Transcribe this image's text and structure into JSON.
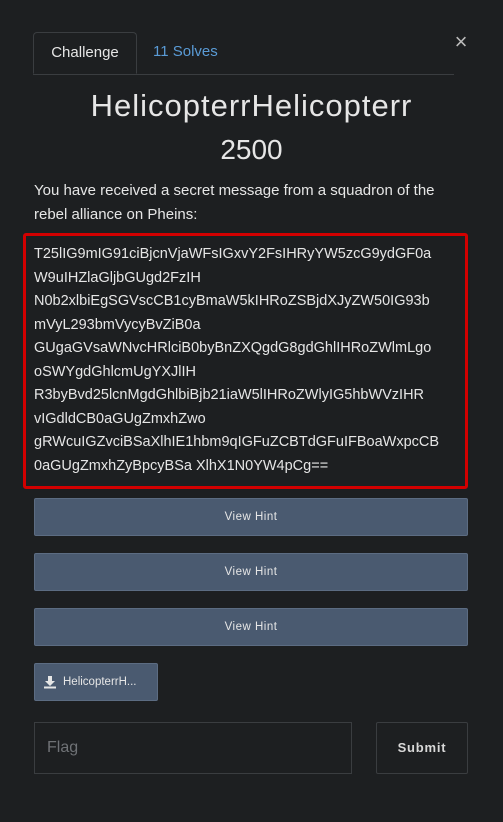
{
  "tabs": {
    "challenge": "Challenge",
    "solves": "11 Solves"
  },
  "close_glyph": "×",
  "challenge": {
    "title": "HelicopterrHelicopterr",
    "points": "2500",
    "description": "You have received a secret message from a squadron of the rebel alliance on Pheins:",
    "ciphertext_lines": [
      "T25lIG9mIG91ciBjcnVjaWFsIGxvY2FsIHRyYW5zcG9ydGF0a",
      "W9uIHZlaGljbGUgd2FzIH",
      "N0b2xlbiEgSGVscCB1cyBmaW5kIHRoZSBjdXJyZW50IG93b",
      "mVyL293bmVycyBvZiB0a",
      "GUgaGVsaWNvcHRlciB0byBnZXQgdG8gdGhlIHRoZWlmLgo",
      "oSWYgdGhlcmUgYXJlIH",
      "R3byBvd25lcnMgdGhlbiBjb21iaW5lIHRoZWlyIG5hbWVzIHR",
      "vIGdldCB0aGUgZmxhZwo",
      "gRWcuIGZvciBSaXlhIE1hbm9qIGFuZCBTdGFuIFBoaWxpcCB",
      "0aGUgZmxhZyBpcyBSa XlhX1N0YW4pCg=="
    ]
  },
  "hints": [
    "View Hint",
    "View Hint",
    "View Hint"
  ],
  "file": {
    "label": "HelicopterrH...",
    "icon": "download-icon"
  },
  "flag": {
    "placeholder": "Flag",
    "value": ""
  },
  "submit_label": "Submit"
}
